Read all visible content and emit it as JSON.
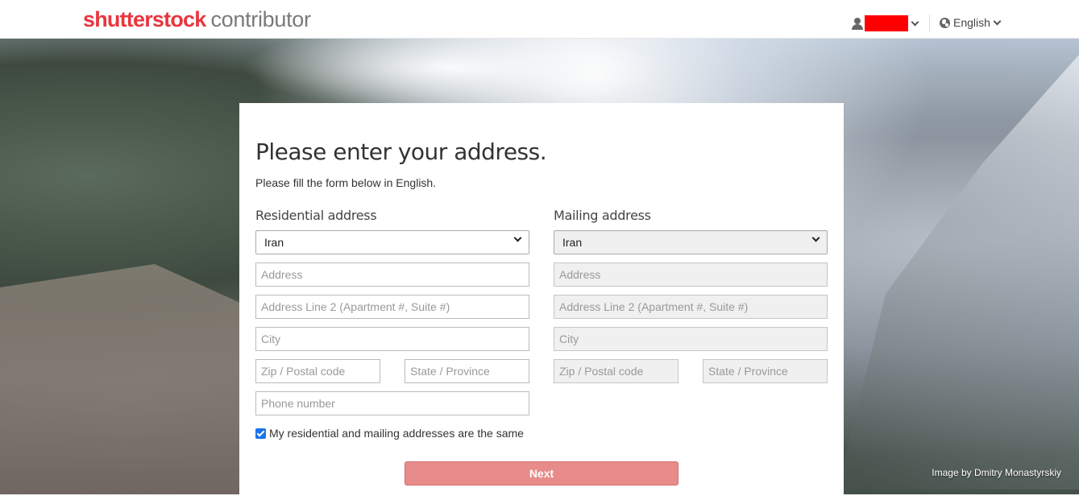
{
  "header": {
    "logo_brand": "shutterstock",
    "logo_sub": "contributor",
    "language": "English"
  },
  "hero": {
    "credit": "Image by Dmitry Monastyrskiy"
  },
  "form": {
    "title": "Please enter your address.",
    "subtitle": "Please fill the form below in English.",
    "residential": {
      "label": "Residential address",
      "country": "Iran",
      "address_placeholder": "Address",
      "address2_placeholder": "Address Line 2 (Apartment #, Suite #)",
      "city_placeholder": "City",
      "zip_placeholder": "Zip / Postal code",
      "state_placeholder": "State / Province",
      "phone_placeholder": "Phone number"
    },
    "mailing": {
      "label": "Mailing address",
      "country": "Iran",
      "address_placeholder": "Address",
      "address2_placeholder": "Address Line 2 (Apartment #, Suite #)",
      "city_placeholder": "City",
      "zip_placeholder": "Zip / Postal code",
      "state_placeholder": "State / Province"
    },
    "same_address_label": "My residential and mailing addresses are the same",
    "same_address_checked": true,
    "next_label": "Next"
  },
  "colors": {
    "brand": "#e8363f",
    "next_button": "#e88b8b",
    "checkbox": "#1a73e8"
  }
}
